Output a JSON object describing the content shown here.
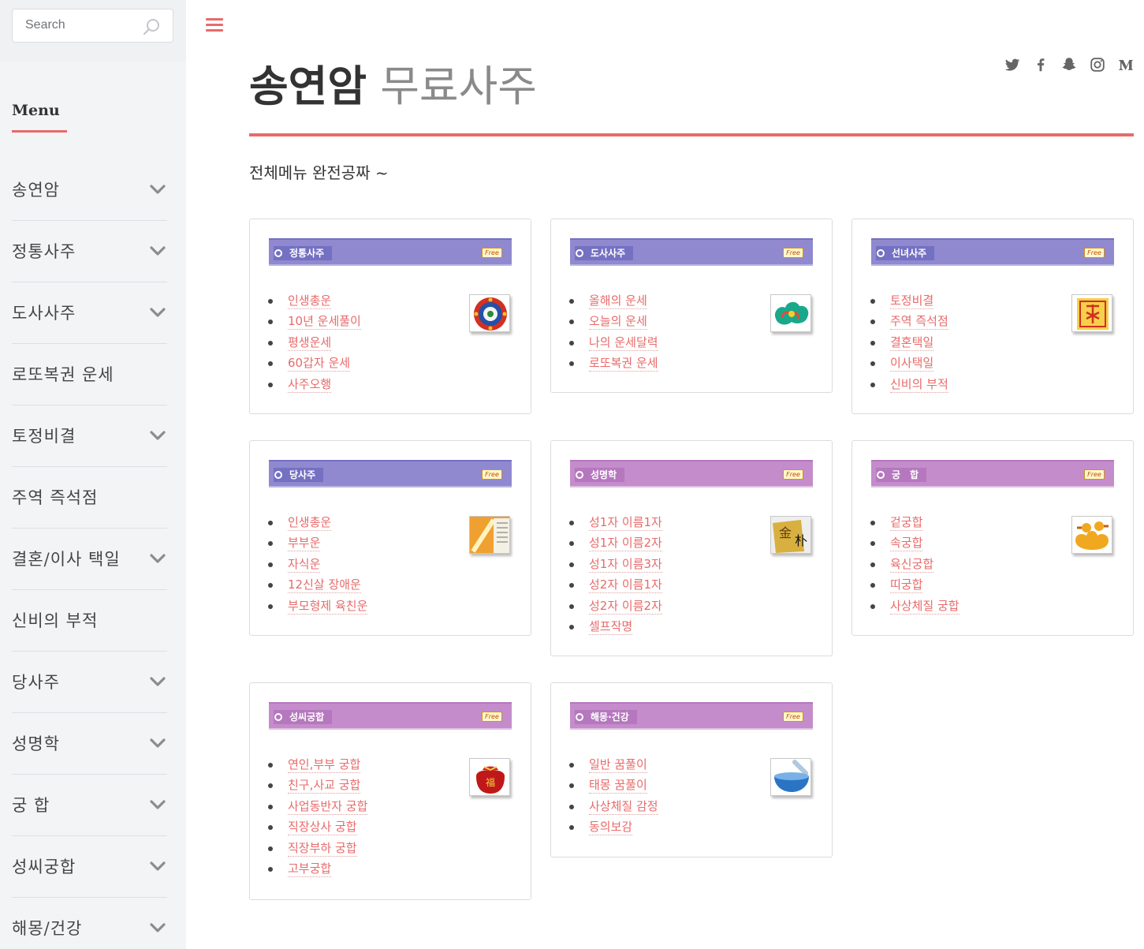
{
  "search": {
    "placeholder": "Search"
  },
  "sidebar": {
    "menu_title": "Menu",
    "items": [
      {
        "label": "송연암",
        "has_children": true
      },
      {
        "label": "정통사주",
        "has_children": true
      },
      {
        "label": "도사사주",
        "has_children": true
      },
      {
        "label": "로또복권 운세",
        "has_children": false
      },
      {
        "label": "토정비결",
        "has_children": true
      },
      {
        "label": "주역 즉석점",
        "has_children": false
      },
      {
        "label": "결혼/이사 택일",
        "has_children": true
      },
      {
        "label": "신비의 부적",
        "has_children": false
      },
      {
        "label": "당사주",
        "has_children": true
      },
      {
        "label": "성명학",
        "has_children": true
      },
      {
        "label": "궁 합",
        "has_children": true
      },
      {
        "label": "성씨궁합",
        "has_children": true
      },
      {
        "label": "해몽/건강",
        "has_children": true
      }
    ]
  },
  "header": {
    "title_main": "송연암",
    "title_sub": "무료사주",
    "social": [
      "twitter-icon",
      "facebook-icon",
      "snapchat-icon",
      "instagram-icon",
      "medium-icon"
    ]
  },
  "intro": "전체메뉴 완전공짜 ~",
  "colors": {
    "accent": "#e86a6a",
    "header_blue": "#9089cf",
    "header_purple": "#c48ccb"
  },
  "cards": [
    {
      "title": "정통사주",
      "badge": "Free",
      "style": "blue",
      "thumb": "mandala-icon",
      "links": [
        "인생총운",
        "10년 운세풀이",
        "평생운세",
        "60갑자 운세",
        "사주오행"
      ]
    },
    {
      "title": "도사사주",
      "badge": "Free",
      "style": "blue",
      "thumb": "cloud-icon",
      "links": [
        "올해의 운세",
        "오늘의 운세",
        "나의 운세달력",
        "로또복권 운세"
      ]
    },
    {
      "title": "선녀사주",
      "badge": "Free",
      "style": "blue",
      "thumb": "talisman-icon",
      "links": [
        "토정비결",
        "주역 즉석점",
        "결혼택일",
        "이사택일",
        "신비의 부적"
      ]
    },
    {
      "title": "당사주",
      "badge": "Free",
      "style": "blue",
      "thumb": "scroll-icon",
      "links": [
        "인생총운",
        "부부운",
        "자식운",
        "12신살 장애운",
        "부모형제 육친운"
      ]
    },
    {
      "title": "성명학",
      "badge": "Free",
      "style": "purple",
      "thumb": "name-seal-icon",
      "links": [
        "성1자 이름1자",
        "성1자 이름2자",
        "성1자 이름3자",
        "성2자 이름1자",
        "성2자 이름2자",
        "셀프작명"
      ]
    },
    {
      "title": "궁　합",
      "badge": "Free",
      "style": "purple",
      "thumb": "ducks-icon",
      "links": [
        "겉궁합",
        "속궁합",
        "육신궁합",
        "띠궁합",
        "사상체질 궁합"
      ]
    },
    {
      "title": "성씨궁합",
      "badge": "Free",
      "style": "purple",
      "thumb": "lucky-pouch-icon",
      "links": [
        "연인,부부 궁합",
        "친구,사교 궁합",
        "사업동반자 궁합",
        "직장상사 궁합",
        "직장부하 궁합",
        "고부궁합"
      ]
    },
    {
      "title": "해몽·건강",
      "badge": "Free",
      "style": "purple",
      "thumb": "mortar-icon",
      "links": [
        "일반 꿈풀이",
        "태몽 꿈풀이",
        "사상체질 감정",
        "동의보감"
      ]
    }
  ]
}
